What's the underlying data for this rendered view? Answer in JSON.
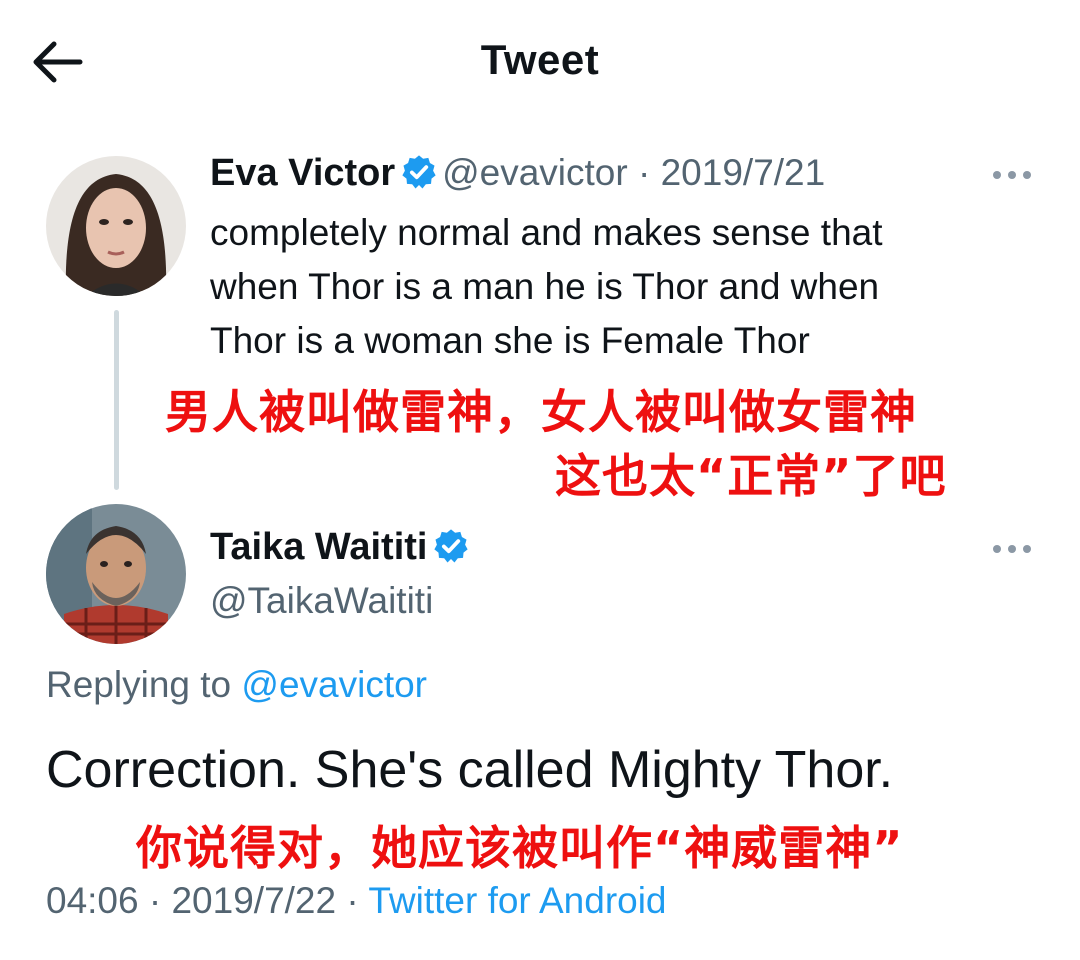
{
  "header": {
    "title": "Tweet",
    "back_icon": "arrow-left-icon"
  },
  "tweet1": {
    "author_name": "Eva Victor",
    "verified_icon": "verified-badge-icon",
    "handle": "@evavictor",
    "separator": "·",
    "date": "2019/7/21",
    "more_icon": "more-horizontal-icon",
    "text_lines": [
      "completely normal and makes sense that",
      "when Thor is a man he is Thor and when",
      "Thor is a woman she is Female Thor"
    ],
    "overlay_lines": [
      "男人被叫做雷神，女人被叫做女雷神",
      "这也太“正常”了吧"
    ]
  },
  "tweet2": {
    "author_name": "Taika Waititi",
    "verified_icon": "verified-badge-icon",
    "handle": "@TaikaWaititi",
    "more_icon": "more-horizontal-icon",
    "replying_prefix": "Replying to",
    "replying_handle": "@evavictor",
    "text": "Correction. She's called Mighty Thor.",
    "overlay_text": "你说得对，她应该被叫作“神威雷神”",
    "time": "04:06",
    "separator": "·",
    "date": "2019/7/22",
    "separator2": "·",
    "source": "Twitter for Android"
  },
  "colors": {
    "accent_blue": "#1d9bf0",
    "overlay_red": "#ee1010",
    "muted_gray": "#536471",
    "thread_line": "#cfd9de"
  }
}
